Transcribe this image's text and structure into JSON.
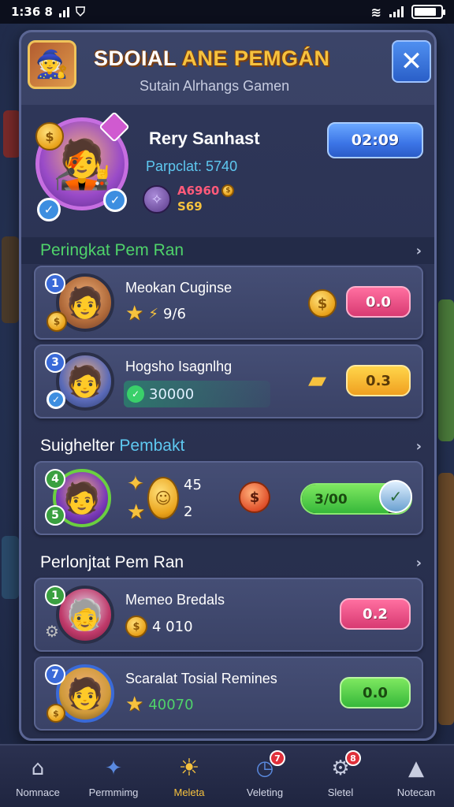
{
  "status_bar": {
    "time": "1:36 8",
    "battery_level": 0.85
  },
  "header": {
    "title_part1": "SDOIAL ",
    "title_part2": "ANE PEMGÁN",
    "subtitle": "Sutain Alrhangs Gamen",
    "close_label": "✕"
  },
  "profile": {
    "name": "Rery Sanhast",
    "participant": "Parpclat: 5740",
    "stat_red": "A6960",
    "stat_gold": "S69",
    "time_button": "02:09"
  },
  "sections": [
    {
      "title": "Peringkat Pem Ran",
      "title_color": "#4fd36a",
      "items": [
        {
          "rank": "1",
          "name": "Meokan Cuginse",
          "sub": "9/6",
          "pill": "0.0",
          "pill_style": "pink"
        },
        {
          "rank": "3",
          "name": "Hogsho Isagnlhg",
          "sub": "30000",
          "pill": "0.3",
          "pill_style": "yellow"
        }
      ]
    },
    {
      "title": "Suighelter",
      "title_accent": "Pembakt",
      "items": [
        {
          "rank": "4",
          "rank2": "5",
          "val1": "45",
          "val2": "2",
          "progress_label": "3/00",
          "progress": 0.8
        }
      ]
    },
    {
      "title": "Perlonjtat Pem Ran",
      "title_color": "#ffffff",
      "items": [
        {
          "rank": "1",
          "name": "Memeo Bredals",
          "sub": "4 010",
          "pill": "0.2",
          "pill_style": "pink"
        },
        {
          "rank": "7",
          "name": "Scaralat Tosial Remines",
          "sub": "40070",
          "pill": "0.0",
          "pill_style": "green"
        }
      ]
    }
  ],
  "bottom_nav": [
    {
      "label": "Nomnace",
      "icon": "home-icon",
      "glyph": "⌂"
    },
    {
      "label": "Permmimg",
      "icon": "tools-icon",
      "glyph": "✦"
    },
    {
      "label": "Meleta",
      "icon": "sun-icon",
      "glyph": "☀"
    },
    {
      "label": "Veleting",
      "icon": "clock-icon",
      "glyph": "◷",
      "badge": "7"
    },
    {
      "label": "Sletel",
      "icon": "gear-icon",
      "glyph": "⚙",
      "badge": "8"
    },
    {
      "label": "Notecan",
      "icon": "warning-icon",
      "glyph": "▲"
    }
  ],
  "colors": {
    "accent_gold": "#f6c23e",
    "accent_blue": "#3b74e6",
    "panel_bg": "#2e3658"
  }
}
